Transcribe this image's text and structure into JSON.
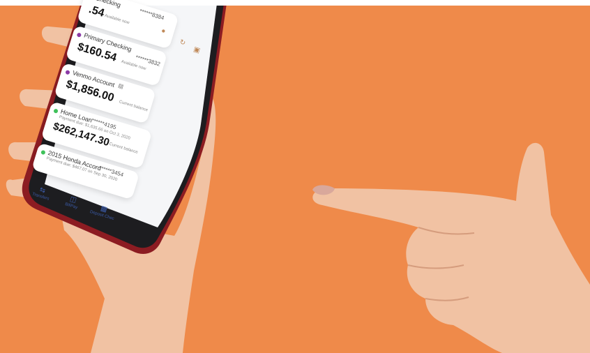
{
  "colors": {
    "background": "#ef8a4a",
    "skin": "#f1c2a3",
    "phone_body": "#1d1d20",
    "phone_frame_red": "#8c1c22",
    "screen": "#f5f6f8",
    "nav_blue": "#3b5ba9",
    "purple_dot": "#8b3aa6",
    "green_dot": "#3fc15a"
  },
  "accounts": [
    {
      "name": "Checking",
      "mask": "******8384",
      "balance": ".54",
      "note": "Available now",
      "dot": "purple"
    },
    {
      "name": "Primary Checking",
      "mask": "******3832",
      "balance": "$160.54",
      "note": "Available now",
      "dot": "purple"
    },
    {
      "name": "Venmo Account",
      "balance": "$1,856.00",
      "note": "Current balance",
      "dot": "purple"
    }
  ],
  "loans": [
    {
      "name": "Home Loan",
      "mask": "******4195",
      "payment": "Payment due: $1,635.66 on Oct 3, 2020",
      "balance": "$262,147.30",
      "note": "Current balance",
      "dot": "green"
    },
    {
      "name": "2015 Honda Accord",
      "mask": "******3454",
      "payment": "Payment due: $467.07 on Sep 30, 2020",
      "dot": "green"
    }
  ],
  "nav": {
    "transfers": "Transfers",
    "billpay": "BillPay",
    "deposit": "Deposit Chec"
  },
  "icons": {
    "refresh": "refresh-icon",
    "camera": "camera-icon",
    "profile": "profile-icon",
    "transfers": "transfers-icon",
    "billpay": "billpay-icon",
    "deposit": "deposit-check-icon"
  }
}
